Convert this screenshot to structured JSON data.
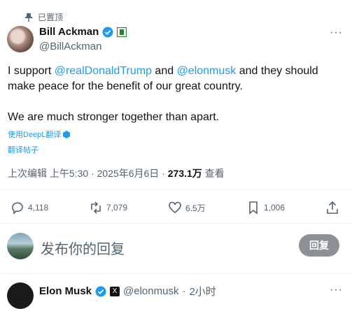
{
  "pinned": {
    "label": "已置顶"
  },
  "tweet": {
    "author": {
      "name": "Bill Ackman",
      "handle": "@BillAckman"
    },
    "text": {
      "line1_pre": "I support ",
      "mention1": "@realDonaldTrump",
      "line1_mid": " and ",
      "mention2": "@elonmusk",
      "line1_post": " and they should make peace for the benefit of our great country.",
      "line2": "We are much stronger together than apart."
    },
    "translate_with": "使用DeepL翻译",
    "translate_post": "翻译帖子",
    "meta": {
      "edited": "上次编辑 上午5:30 · 2025年6月6日 · ",
      "views_count": "273.1万",
      "views_label": " 查看"
    },
    "actions": {
      "replies": "4,118",
      "reposts": "7,079",
      "likes": "6.5万",
      "bookmarks": "1,006"
    },
    "more_icon": "more-icon"
  },
  "reply_box": {
    "placeholder": "发布你的回复",
    "button_label": "回复"
  },
  "next_reply": {
    "name": "Elon Musk",
    "handle": "@elonmusk",
    "sep": "·",
    "time": "2小时"
  },
  "colors": {
    "accent": "#1d9bf0",
    "text": "#0f1419",
    "muted": "#536471",
    "reply_button": "#8b9196"
  }
}
